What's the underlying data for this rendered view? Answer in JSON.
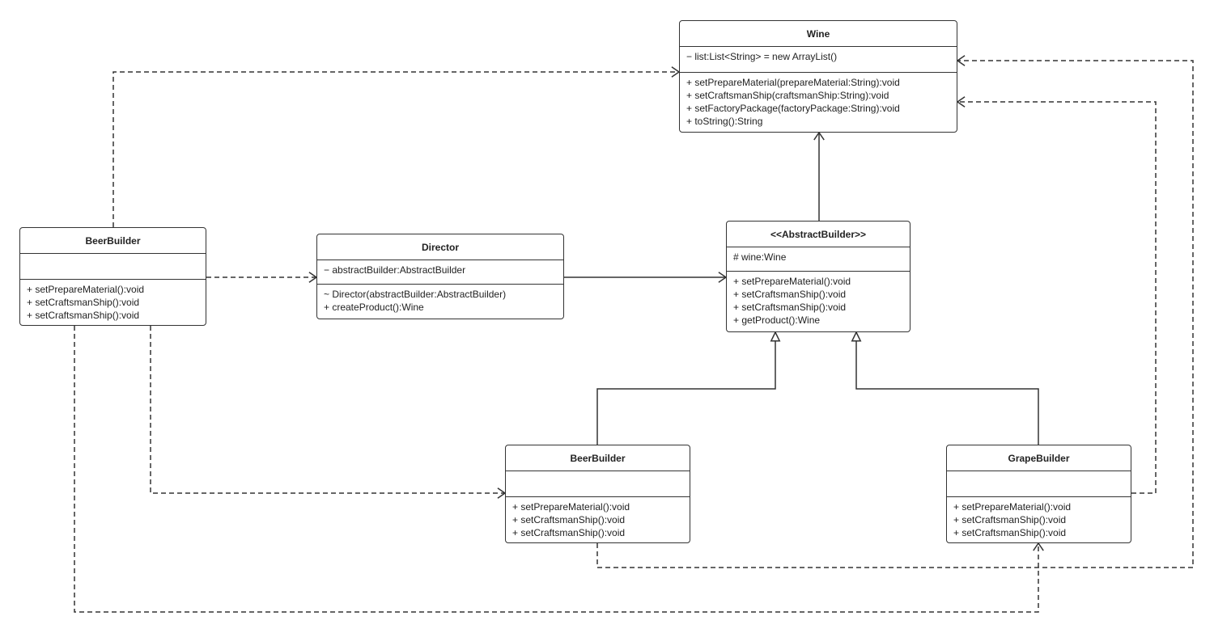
{
  "classes": {
    "wine": {
      "name": "Wine",
      "attributes": [
        "− list:List<String> = new ArrayList()"
      ],
      "methods": [
        "+ setPrepareMaterial(prepareMaterial:String):void",
        "+ setCraftsmanShip(craftsmanShip:String):void",
        "+ setFactoryPackage(factoryPackage:String):void",
        "+ toString():String"
      ]
    },
    "beer_left": {
      "name": "BeerBuilder",
      "attributes": [],
      "methods": [
        "+ setPrepareMaterial():void",
        "+ setCraftsmanShip():void",
        "+ setCraftsmanShip():void"
      ]
    },
    "director": {
      "name": "Director",
      "attributes": [
        "− abstractBuilder:AbstractBuilder"
      ],
      "methods": [
        "~ Director(abstractBuilder:AbstractBuilder)",
        "+ createProduct():Wine"
      ]
    },
    "abstract": {
      "name": "<<AbstractBuilder>>",
      "attributes": [
        "# wine:Wine"
      ],
      "methods": [
        "+ setPrepareMaterial():void",
        "+ setCraftsmanShip():void",
        "+ setCraftsmanShip():void",
        "+ getProduct():Wine"
      ]
    },
    "beer_bottom": {
      "name": "BeerBuilder",
      "attributes": [],
      "methods": [
        "+ setPrepareMaterial():void",
        "+ setCraftsmanShip():void",
        "+ setCraftsmanShip():void"
      ]
    },
    "grape": {
      "name": "GrapeBuilder",
      "attributes": [],
      "methods": [
        "+ setPrepareMaterial():void",
        "+ setCraftsmanShip():void",
        "+ setCraftsmanShip():void"
      ]
    }
  },
  "relations": [
    {
      "from": "beer_left",
      "to": "wine",
      "type": "dependency"
    },
    {
      "from": "beer_left",
      "to": "director",
      "type": "dependency"
    },
    {
      "from": "beer_left",
      "to": "beer_bottom",
      "type": "dependency"
    },
    {
      "from": "beer_left",
      "to": "grape",
      "type": "dependency"
    },
    {
      "from": "director",
      "to": "abstract",
      "type": "association"
    },
    {
      "from": "abstract",
      "to": "wine",
      "type": "association"
    },
    {
      "from": "beer_bottom",
      "to": "abstract",
      "type": "generalization"
    },
    {
      "from": "grape",
      "to": "abstract",
      "type": "generalization"
    },
    {
      "from": "grape",
      "to": "wine",
      "type": "dependency"
    },
    {
      "from": "beer_bottom",
      "to": "wine",
      "type": "dependency"
    }
  ],
  "colors": {
    "stroke": "#333333",
    "background": "#ffffff"
  }
}
